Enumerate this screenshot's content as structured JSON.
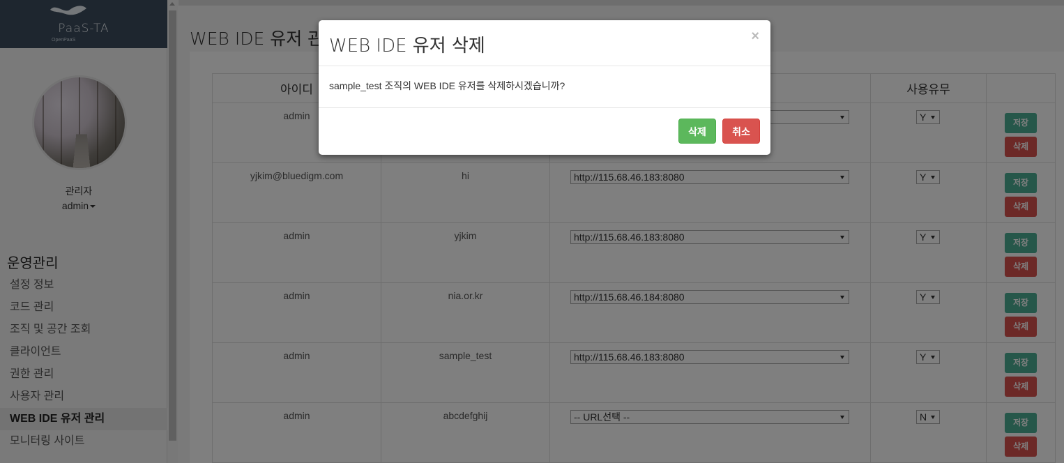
{
  "sidebar": {
    "logo_text": "PaaS-TA",
    "logo_sub": "OpenPaaS",
    "user_name": "관리자",
    "user_id": "admin",
    "menu_title": "운영관리",
    "items": [
      {
        "label": "설정 정보"
      },
      {
        "label": "코드 관리"
      },
      {
        "label": "조직 및 공간 조회"
      },
      {
        "label": "클라이언트"
      },
      {
        "label": "권한 관리"
      },
      {
        "label": "사용자 관리"
      },
      {
        "label": "WEB IDE 유저 관리",
        "active": true
      },
      {
        "label": "모니터링 사이트"
      }
    ]
  },
  "page_title": "WEB IDE 유저 관리",
  "table": {
    "headers": [
      "아이디",
      "",
      "",
      "사용유무",
      ""
    ],
    "rows": [
      {
        "id": "admin",
        "org": "",
        "url": "",
        "use": "Y"
      },
      {
        "id": "yjkim@bluedigm.com",
        "org": "hi",
        "url": "http://115.68.46.183:8080",
        "use": "Y"
      },
      {
        "id": "admin",
        "org": "yjkim",
        "url": "http://115.68.46.183:8080",
        "use": "Y"
      },
      {
        "id": "admin",
        "org": "nia.or.kr",
        "url": "http://115.68.46.184:8080",
        "use": "Y"
      },
      {
        "id": "admin",
        "org": "sample_test",
        "url": "http://115.68.46.183:8080",
        "use": "Y"
      },
      {
        "id": "admin",
        "org": "abcdefghij",
        "url": "-- URL선택 --",
        "use": "N"
      }
    ],
    "save_label": "저장",
    "delete_label": "삭제"
  },
  "modal": {
    "title": "WEB IDE 유저 삭제",
    "message": "sample_test 조직의 WEB IDE 유저를 삭제하시겠습니까?",
    "close": "×",
    "confirm_label": "삭제",
    "cancel_label": "취소"
  },
  "colors": {
    "sidebar_logo_bg": "#3d4d5e",
    "save_button": "#4cae94",
    "delete_button": "#d9534f",
    "confirm_button": "#5cb85c"
  }
}
